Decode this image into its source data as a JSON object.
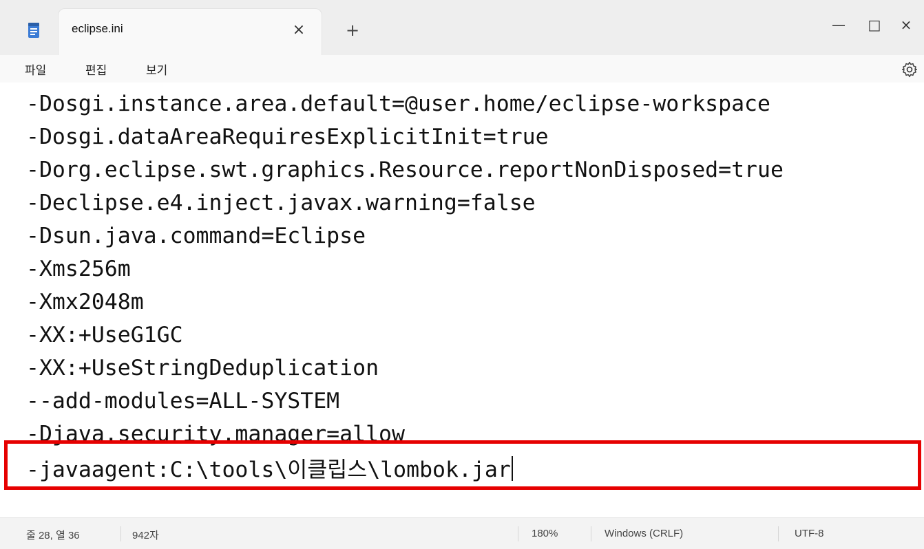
{
  "window": {
    "tab_title": "eclipse.ini",
    "tab_close_glyph": "×",
    "new_tab_glyph": "+",
    "minimize_glyph": "—",
    "maximize_glyph": "□",
    "close_glyph": "×"
  },
  "menu": {
    "file": "파일",
    "edit": "편집",
    "view": "보기"
  },
  "editor": {
    "lines": [
      "-Dosgi.instance.area.default=@user.home/eclipse-workspace",
      "-Dosgi.dataAreaRequiresExplicitInit=true",
      "-Dorg.eclipse.swt.graphics.Resource.reportNonDisposed=true",
      "-Declipse.e4.inject.javax.warning=false",
      "-Dsun.java.command=Eclipse",
      "-Xms256m",
      "-Xmx2048m",
      "-XX:+UseG1GC",
      "-XX:+UseStringDeduplication",
      "--add-modules=ALL-SYSTEM",
      "-Djava.security.manager=allow",
      "-javaagent:C:\\tools\\이클립스\\lombok.jar"
    ]
  },
  "status": {
    "position": "줄 28, 열 36",
    "char_count": "942자",
    "zoom": "180%",
    "line_ending": "Windows (CRLF)",
    "encoding": "UTF-8"
  },
  "colors": {
    "highlight": "#e60000",
    "app_icon": "#3a7bd5"
  }
}
